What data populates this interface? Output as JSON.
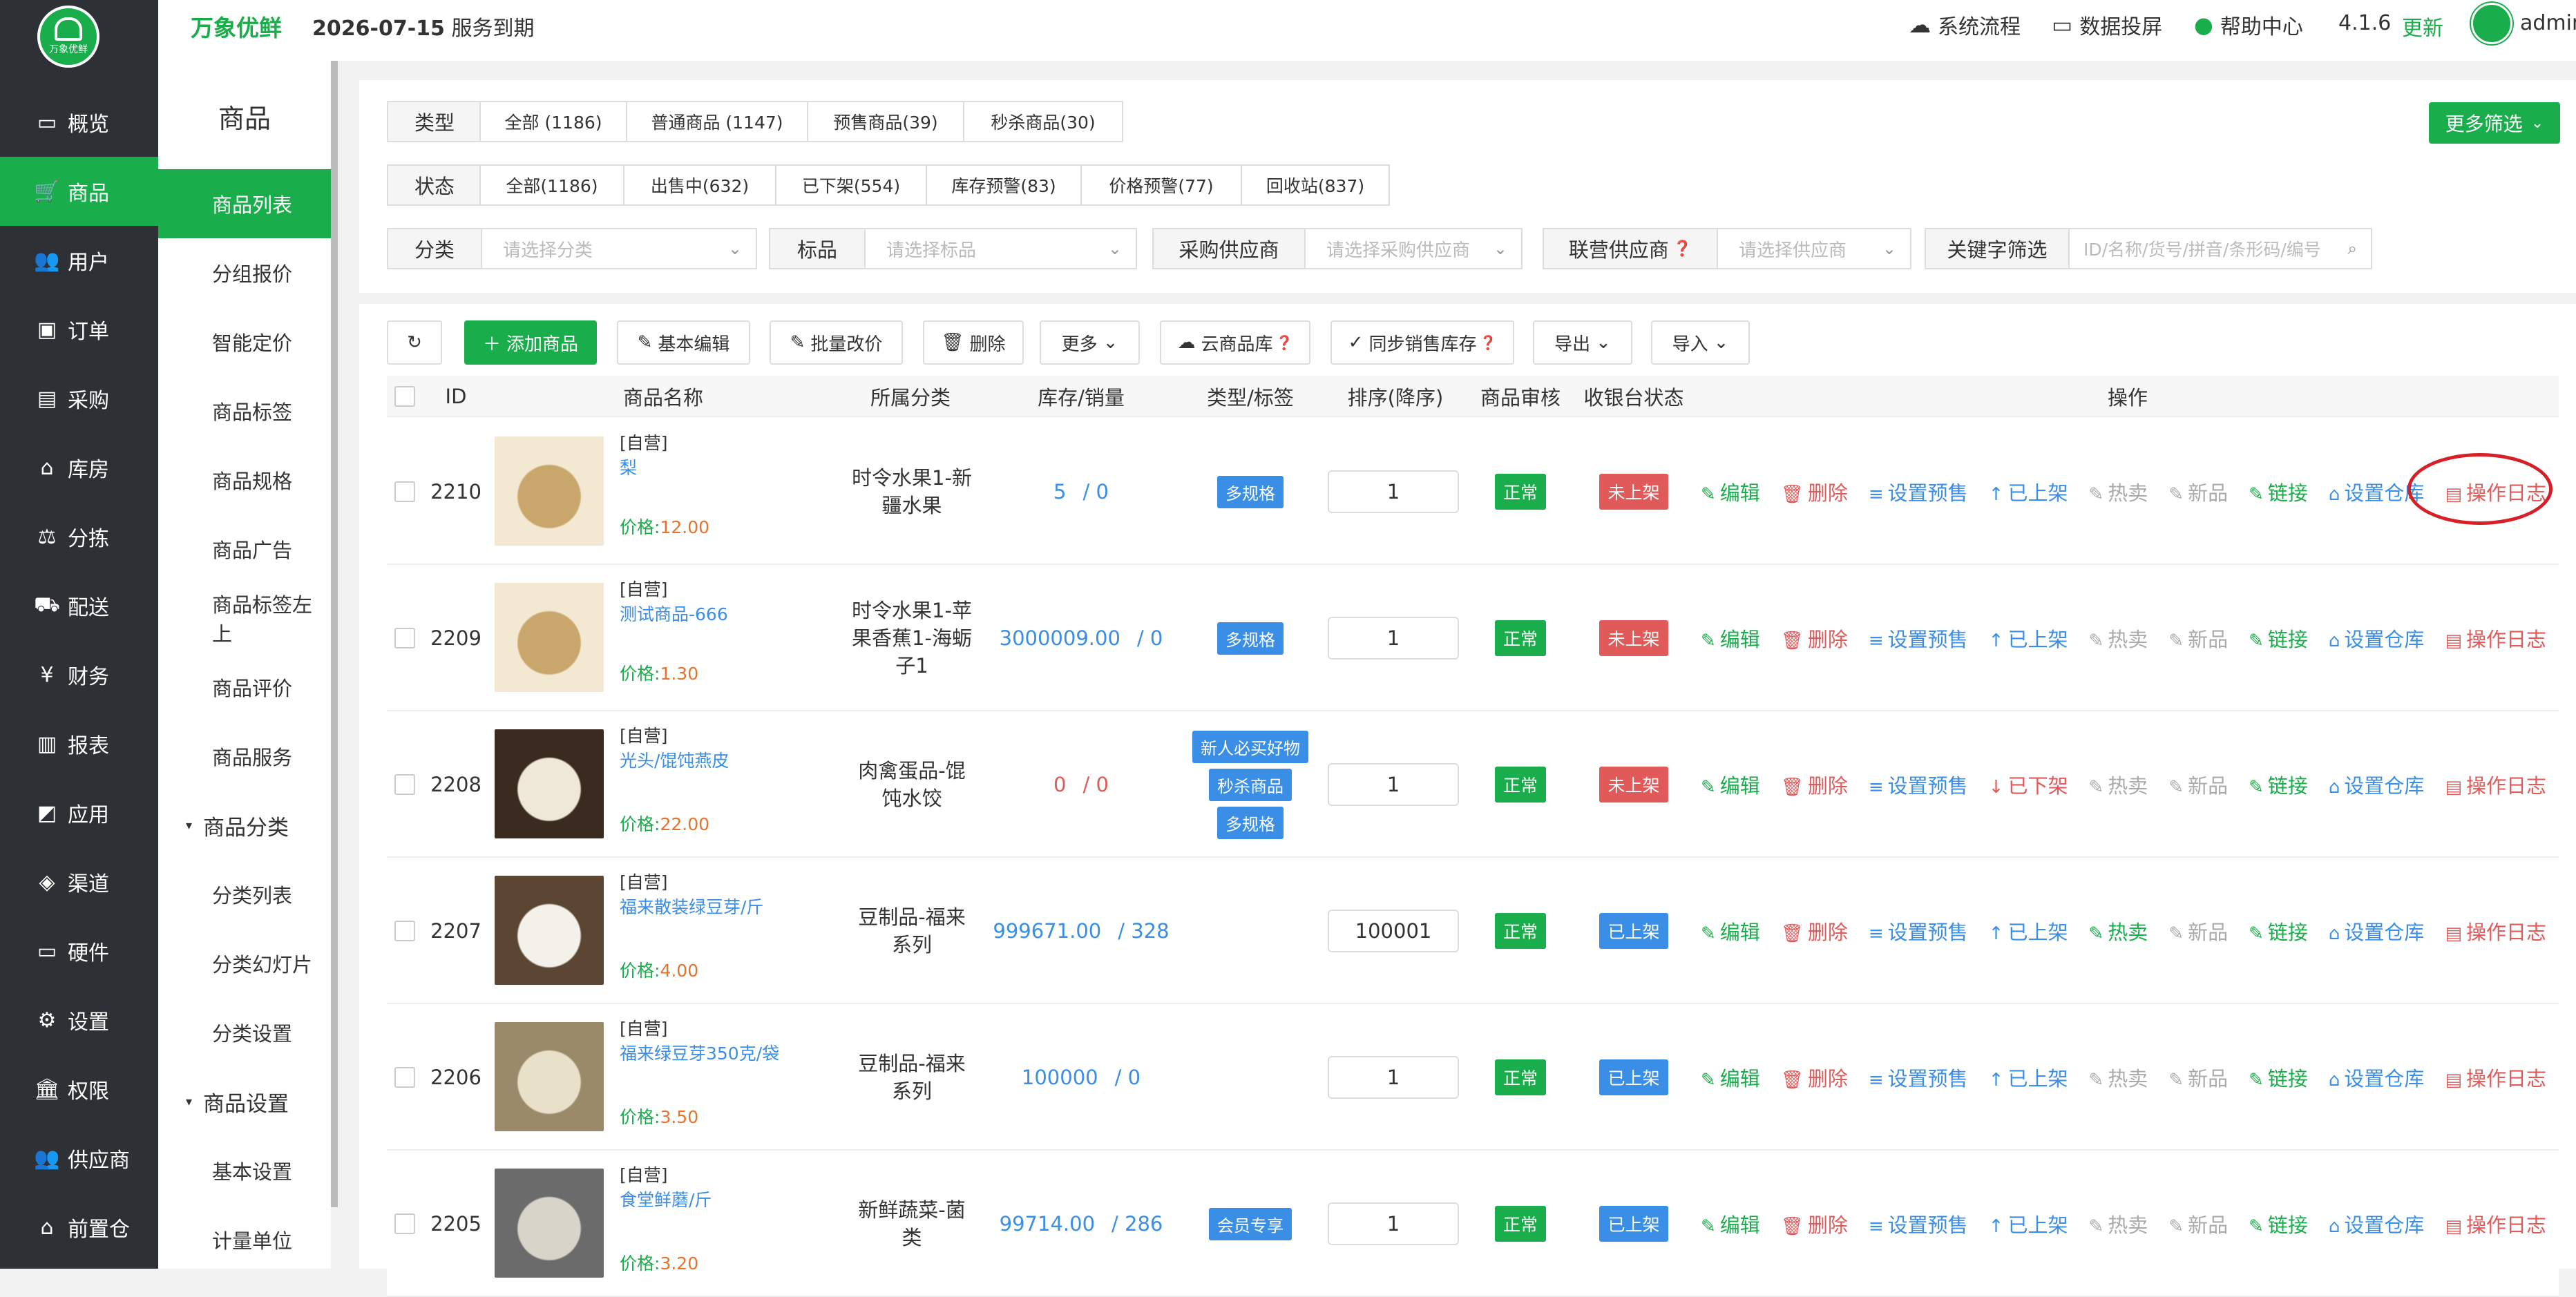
{
  "app": {
    "logo_text": "万象优鲜",
    "brand": "万象优鲜",
    "expire_date": "2026-07-15",
    "expire_suffix": "服务到期"
  },
  "topbar": {
    "links": [
      {
        "icon": "process-icon",
        "label": "系统流程"
      },
      {
        "icon": "monitor-icon",
        "label": "数据投屏"
      },
      {
        "icon": "location-icon",
        "label": "帮助中心"
      }
    ],
    "version": "4.1.6",
    "update": "更新",
    "user": "admin"
  },
  "sidebar": {
    "items": [
      {
        "icon": "monitor-icon",
        "label": "概览"
      },
      {
        "icon": "cart-icon",
        "label": "商品"
      },
      {
        "icon": "users-icon",
        "label": "用户"
      },
      {
        "icon": "order-icon",
        "label": "订单"
      },
      {
        "icon": "truck-icon",
        "label": "采购"
      },
      {
        "icon": "home-icon",
        "label": "库房"
      },
      {
        "icon": "scale-icon",
        "label": "分拣"
      },
      {
        "icon": "delivery-icon",
        "label": "配送"
      },
      {
        "icon": "yen-icon",
        "label": "财务"
      },
      {
        "icon": "chart-icon",
        "label": "报表"
      },
      {
        "icon": "apps-icon",
        "label": "应用"
      },
      {
        "icon": "cube-icon",
        "label": "渠道"
      },
      {
        "icon": "desktop-icon",
        "label": "硬件"
      },
      {
        "icon": "settings-icon",
        "label": "设置"
      },
      {
        "icon": "bank-icon",
        "label": "权限"
      },
      {
        "icon": "supplier-icon",
        "label": "供应商"
      },
      {
        "icon": "warehouse-icon",
        "label": "前置仓"
      }
    ]
  },
  "submenu": {
    "title": "商品",
    "items": [
      "商品列表",
      "分组报价",
      "智能定价",
      "商品标签",
      "商品规格",
      "商品广告",
      "商品标签左上",
      "商品评价",
      "商品服务"
    ],
    "group1": "商品分类",
    "group1_items": [
      "分类列表",
      "分类幻灯片",
      "分类设置"
    ],
    "group2": "商品设置",
    "group2_items": [
      "基本设置",
      "计量单位"
    ]
  },
  "filters": {
    "type_label": "类型",
    "type_options": [
      "全部 (1186)",
      "普通商品 (1147)",
      "预售商品(39)",
      "秒杀商品(30)"
    ],
    "status_label": "状态",
    "status_options": [
      "全部(1186)",
      "出售中(632)",
      "已下架(554)",
      "库存预警(83)",
      "价格预警(77)",
      "回收站(837)"
    ],
    "category_label": "分类",
    "category_placeholder": "请选择分类",
    "tag_label": "标品",
    "tag_placeholder": "请选择标品",
    "purchase_supplier_label": "采购供应商",
    "purchase_supplier_placeholder": "请选择采购供应商",
    "joint_supplier_label": "联营供应商",
    "joint_supplier_placeholder": "请选择供应商",
    "keyword_label": "关键字筛选",
    "keyword_placeholder": "ID/名称/货号/拼音/条形码/编号",
    "more_filter": "更多筛选"
  },
  "toolbar": {
    "add": "添加商品",
    "basic_edit": "基本编辑",
    "batch_price": "批量改价",
    "delete": "删除",
    "more": "更多",
    "cloud": "云商品库",
    "sync": "同步销售库存",
    "export": "导出",
    "import": "导入"
  },
  "table": {
    "headers": [
      "ID",
      "商品名称",
      "所属分类",
      "库存/销量",
      "类型/标签",
      "排序(降序)",
      "商品审核",
      "收银台状态",
      "操作"
    ],
    "price_label": "价格:",
    "self_label": "[自营]",
    "rows": [
      {
        "id": "2210",
        "name": "梨",
        "price": "12.00",
        "category": "时令水果1-新疆水果",
        "stock": "5",
        "sales": "/ 0",
        "tags": [
          "多规格"
        ],
        "sort": "1",
        "audit": "正常",
        "cashier": "未上架",
        "shelf": "已上架"
      },
      {
        "id": "2209",
        "name": "测试商品-666",
        "price": "1.30",
        "category": "时令水果1-苹果香蕉1-海蛎子1",
        "stock": "3000009.00",
        "sales": "/ 0",
        "tags": [
          "多规格"
        ],
        "sort": "1",
        "audit": "正常",
        "cashier": "未上架",
        "shelf": "已上架"
      },
      {
        "id": "2208",
        "name": "光头/馄饨燕皮",
        "price": "22.00",
        "category": "肉禽蛋品-馄饨水饺",
        "stock": "0",
        "sales": "/ 0",
        "tags": [
          "新人必买好物",
          "秒杀商品",
          "多规格"
        ],
        "sort": "1",
        "audit": "正常",
        "cashier": "未上架",
        "shelf": "已下架"
      },
      {
        "id": "2207",
        "name": "福来散装绿豆芽/斤",
        "price": "4.00",
        "category": "豆制品-福来系列",
        "stock": "999671.00",
        "sales": "/ 328",
        "tags": [],
        "sort": "100001",
        "audit": "正常",
        "cashier": "已上架",
        "shelf": "已上架"
      },
      {
        "id": "2206",
        "name": "福来绿豆芽350克/袋",
        "price": "3.50",
        "category": "豆制品-福来系列",
        "stock": "100000",
        "sales": "/ 0",
        "tags": [],
        "sort": "1",
        "audit": "正常",
        "cashier": "已上架",
        "shelf": "已上架"
      },
      {
        "id": "2205",
        "name": "食堂鲜蘑/斤",
        "price": "3.20",
        "category": "新鲜蔬菜-菌类",
        "stock": "99714.00",
        "sales": "/ 286",
        "tags": [
          "会员专享"
        ],
        "sort": "1",
        "audit": "正常",
        "cashier": "已上架",
        "shelf": "已上架"
      }
    ],
    "ops": {
      "edit": "编辑",
      "delete": "删除",
      "presale": "设置预售",
      "hot": "热卖",
      "new": "新品",
      "link": "链接",
      "warehouse": "设置仓库",
      "log": "操作日志"
    }
  },
  "colors": {
    "brand": "#1aad4b",
    "sidebar": "#2d3136",
    "link": "#3a8ee6",
    "danger": "#e05a5a",
    "highlight_circle": "#d61f26"
  }
}
